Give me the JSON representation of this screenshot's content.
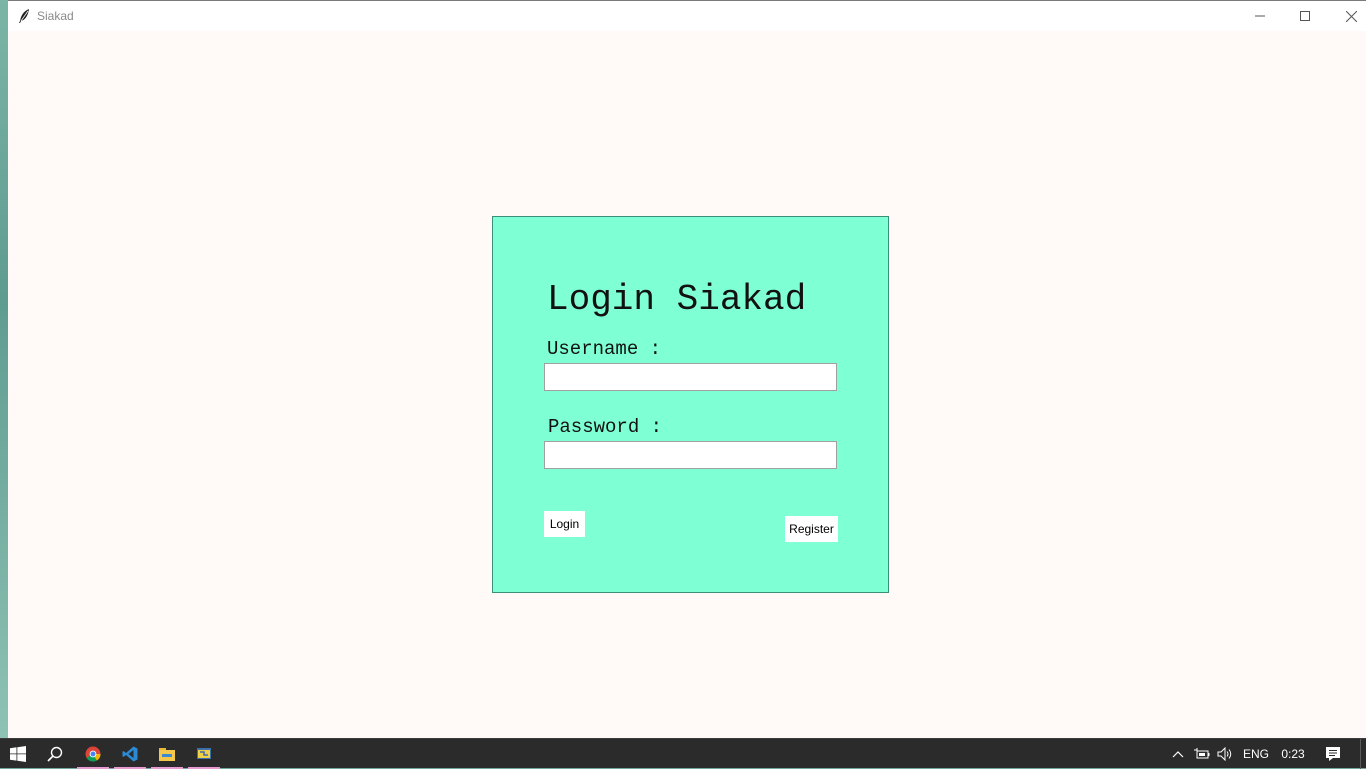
{
  "window": {
    "title": "Siakad",
    "icon": "feather-icon"
  },
  "login": {
    "title": "Login Siakad",
    "username_label": "Username :",
    "username_value": "",
    "password_label": "Password :",
    "password_value": "",
    "login_button": "Login",
    "register_button": "Register",
    "panel_color": "#7fffd4"
  },
  "taskbar": {
    "apps": [
      "chrome-icon",
      "vscode-icon",
      "file-explorer-icon",
      "python-icon"
    ],
    "tray": {
      "language": "ENG",
      "clock": "0:23"
    }
  },
  "colors": {
    "window_background": "#fffaf8",
    "taskbar_background": "#2b2b2b",
    "active_app_indicator": "#e89bd2"
  }
}
